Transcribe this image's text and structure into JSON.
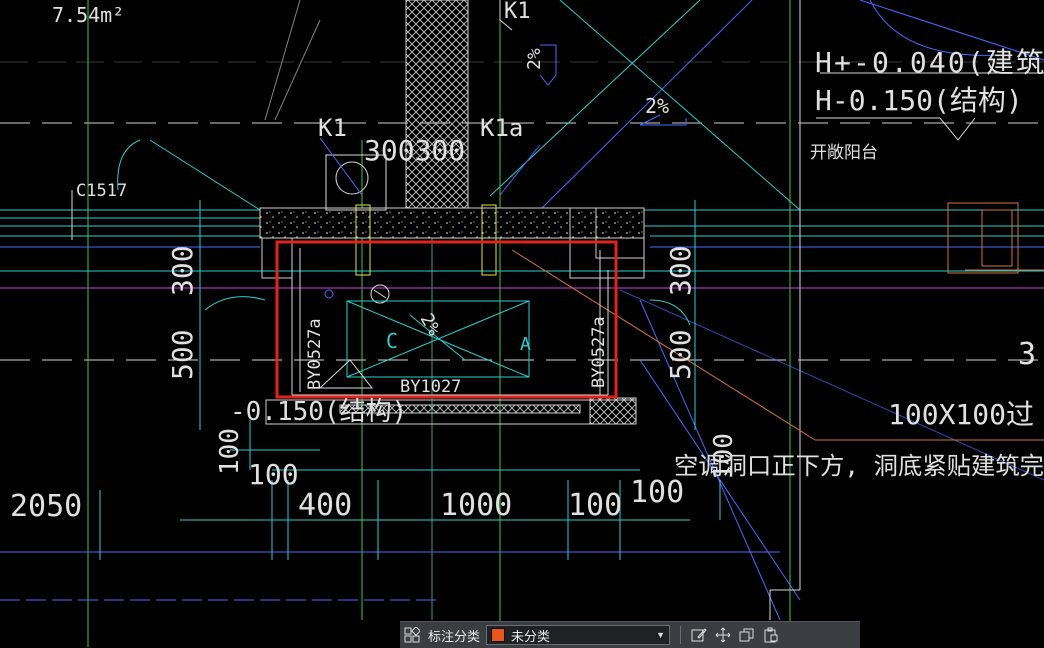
{
  "drawing": {
    "area_label": "7.54m²",
    "elevation_building": "H+-0.040(建筑",
    "elevation_structure": "H-0.150(结构)",
    "balcony_note": "开敞阳台",
    "slope_1": "2%",
    "slope_2": "2%",
    "slope_3": "2%",
    "marker_k1_top": "K1",
    "marker_k1": "K1",
    "marker_k1a": "K1a",
    "dim_300_300": "300300",
    "window_code": "C1517",
    "dim_300_left": "300",
    "dim_500_left": "500",
    "dim_300_right": "300",
    "dim_500_right": "500",
    "beam_left": "BY0527a",
    "beam_right": "BY0527a",
    "beam_bottom": "BY1027",
    "label_c": "C",
    "label_a": "A",
    "level_note": "-0.150(结构)",
    "dim_100_vert_left": "100",
    "dim_100_vert_right": "100",
    "dim_100_a": "100",
    "dim_100_b": "100",
    "dim_100_c": "100",
    "dim_2050": "2050",
    "dim_400": "400",
    "dim_1000": "1000",
    "opening_size": "100X100过",
    "ac_note": "空调洞口正下方, 洞底紧贴建筑完",
    "partial_3": "3"
  },
  "toolbar": {
    "annotation_label": "标注分类",
    "category_value": "未分类",
    "category_color": "#e8561b"
  }
}
